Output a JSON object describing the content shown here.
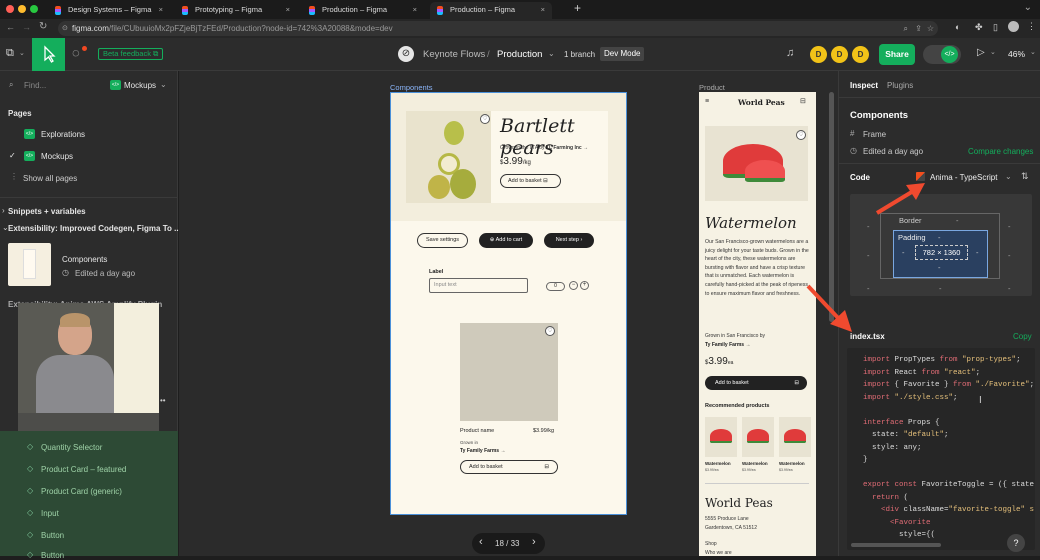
{
  "browser": {
    "tabs": [
      {
        "label": "Design Systems – Figma"
      },
      {
        "label": "Prototyping – Figma"
      },
      {
        "label": "Production – Figma"
      },
      {
        "label": "Production – Figma"
      }
    ],
    "new_tab": "+",
    "url_host": "figma.com",
    "url_path": "/file/CUbuuioMx2pFZjeBjTzFEd/Production?node-id=742%3A20088&mode=dev"
  },
  "toolbar": {
    "beta_feedback": "Beta feedback",
    "project": "Keynote Flows",
    "separator": "/",
    "file": "Production",
    "branch": "1 branch",
    "dev_mode": "Dev Mode",
    "avatars": [
      "D",
      "D",
      "D"
    ],
    "share": "Share",
    "zoom": "46%",
    "colors": {
      "accent_green": "#14ae5c",
      "avatar_yellow": "#f2c318"
    }
  },
  "left_panel": {
    "find_placeholder": "Find...",
    "page_selector": "Mockups",
    "pages_heading": "Pages",
    "pages": [
      "Explorations",
      "Mockups"
    ],
    "show_all": "Show all pages",
    "snippets": "Snippets + variables",
    "extensibility": "Extensibility: Improved Codegen, Figma To ...",
    "frame_name": "Components",
    "frame_time": "Edited a day ago",
    "partial_row": "Extensibility: Anima AWS Amplify Plugin",
    "layers": [
      "Quantity Selector",
      "Product Card – featured",
      "Product Card (generic)",
      "Input",
      "Button",
      "Button"
    ]
  },
  "canvas": {
    "components_label": "Components",
    "product_label": "Product",
    "pager": "18 / 33",
    "components_frame": {
      "title": "Bartlett pears",
      "grown_in": "Grown in the LTA by ",
      "grown_farm": "TL Farming Inc →",
      "price_dollar": "$",
      "price": "3.99",
      "price_unit": "/kg",
      "add_basket": "Add to basket",
      "save_settings": "Save settings",
      "add_cart": "Add to cart",
      "next_step": "Next step",
      "label": "Label",
      "input_placeholder": "Input text",
      "qty": "0",
      "product_name": "Product name",
      "product_price": "$3.99/kg",
      "grown_small": "Grown in",
      "farm_small": "Ty Family Farms →",
      "add_basket2": "Add to basket"
    },
    "product_frame": {
      "brand": "World Peas",
      "title": "Watermelon",
      "description": "Our San Francisco-grown watermelons are a juicy delight for your taste buds. Grown in the heart of the city, these watermelons are bursting with flavor and have a crisp texture that is unmatched. Each watermelon is carefully hand-picked at the peak of ripeness to ensure maximum flavor and freshness.",
      "grown": "Grown in San Francisco by",
      "farm": "Ty Family Farms →",
      "price_dollar": "$",
      "price": "3.99",
      "price_cents": "ea",
      "add_basket": "Add to basket",
      "recommended": "Recommended products",
      "rec_items": [
        {
          "name": "Watermelon",
          "price": "$3.99/ea"
        },
        {
          "name": "Watermelon",
          "price": "$3.99/ea"
        },
        {
          "name": "Watermelon",
          "price": "$3.99/ea"
        }
      ],
      "footer_brand": "World Peas",
      "address1": "5555 Produce Lane",
      "address2": "Gardentown, CA 51512",
      "shop": "Shop",
      "who": "Who we are"
    }
  },
  "right_panel": {
    "tabs": [
      "Inspect",
      "Plugins"
    ],
    "title": "Components",
    "frame": "Frame",
    "edited": "Edited a day ago",
    "compare": "Compare changes",
    "code_label": "Code",
    "code_lang": "Anima - TypeScript",
    "box_border": "Border",
    "box_padding": "Padding",
    "box_size": "782 × 1360",
    "box_dash": "-",
    "file_name": "index.tsx",
    "copy": "Copy",
    "code_lines": [
      {
        "p": [
          [
            "import ",
            "kw"
          ],
          [
            "PropTypes ",
            ""
          ],
          [
            "from ",
            "kw"
          ],
          [
            "\"prop-types\"",
            "st"
          ],
          [
            ";",
            ""
          ]
        ]
      },
      {
        "p": [
          [
            "import ",
            "kw"
          ],
          [
            "React ",
            ""
          ],
          [
            "from ",
            "kw"
          ],
          [
            "\"react\"",
            "st"
          ],
          [
            ";",
            ""
          ]
        ]
      },
      {
        "p": [
          [
            "import ",
            "kw"
          ],
          [
            "{ Favorite } ",
            ""
          ],
          [
            "from ",
            "kw"
          ],
          [
            "\"./Favorite\"",
            "st"
          ],
          [
            ";",
            ""
          ]
        ]
      },
      {
        "p": [
          [
            "import ",
            "kw"
          ],
          [
            "\"./style.css\"",
            "st"
          ],
          [
            ";",
            ""
          ]
        ]
      },
      {
        "p": []
      },
      {
        "p": [
          [
            "interface ",
            "kw"
          ],
          [
            "Props {",
            ""
          ]
        ]
      },
      {
        "p": [
          [
            "  state: ",
            ""
          ],
          [
            "\"default\"",
            "st"
          ],
          [
            ";",
            ""
          ]
        ]
      },
      {
        "p": [
          [
            "  style: any;",
            ""
          ]
        ]
      },
      {
        "p": [
          [
            "}",
            ""
          ]
        ]
      },
      {
        "p": []
      },
      {
        "p": [
          [
            "export ",
            "kw"
          ],
          [
            "const ",
            "kw"
          ],
          [
            "FavoriteToggle = ({ state,",
            ""
          ]
        ]
      },
      {
        "p": [
          [
            "  return ",
            "kw"
          ],
          [
            "(",
            ""
          ]
        ]
      },
      {
        "p": [
          [
            "    <div ",
            "kw"
          ],
          [
            "className=",
            ""
          ],
          [
            "\"favorite-toggle\" s",
            "st"
          ]
        ]
      },
      {
        "p": [
          [
            "      <Favorite",
            "kw"
          ]
        ]
      },
      {
        "p": [
          [
            "        style={(",
            ""
          ]
        ]
      }
    ],
    "help": "?"
  }
}
